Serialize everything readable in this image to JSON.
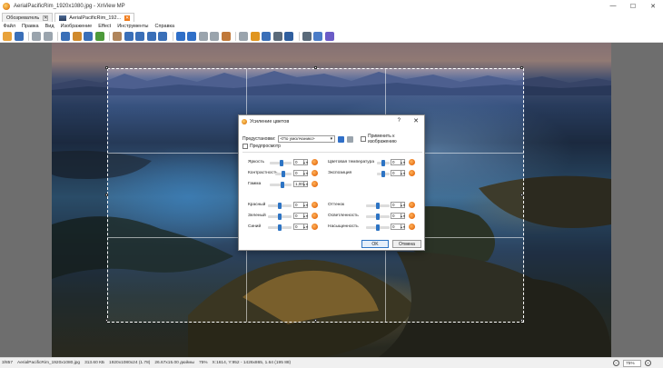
{
  "window": {
    "title": "AerialPacificRim_1920x1080.jpg - XnView MP",
    "minimize": "—",
    "maximize": "☐",
    "close": "✕"
  },
  "tabs": [
    {
      "label": "Обозреватель",
      "close": "✕"
    },
    {
      "label": "AerialPacificRim_192...",
      "close": "✕"
    }
  ],
  "menu": [
    "Файл",
    "Правка",
    "Вид",
    "Изображение",
    "Effect",
    "Инструменты",
    "Справка"
  ],
  "toolbar": {
    "icons": [
      "browse-icon",
      "save-icon",
      "undo-icon",
      "redo-icon",
      "fullscreen-icon",
      "filmstrip-icon",
      "thumbnail-icon",
      "refresh-icon",
      "resize-icon",
      "zoom-in-icon",
      "zoom-out-icon",
      "zoom-fit-icon",
      "zoom-actual-icon",
      "prev-icon",
      "next-icon",
      "rotate-left-icon",
      "rotate-right-icon",
      "crop-icon",
      "flip-icon",
      "adjust-icon",
      "settings-icon",
      "print-icon",
      "slideshow-icon",
      "color-icon",
      "info-icon",
      "help-icon"
    ],
    "colors": [
      "#e8a23a",
      "#3a6fb8",
      "#9aa4ad",
      "#9aa4ad",
      "#3a6fb8",
      "#d08a2c",
      "#3a6fb8",
      "#4d9a3a",
      "#b0855b",
      "#3a6fb8",
      "#3a6fb8",
      "#3a6fb8",
      "#3a6fb8",
      "#2f6fc8",
      "#2f6fc8",
      "#9aa4ad",
      "#9aa4ad",
      "#c0793a",
      "#9aa4ad",
      "#e0951f",
      "#3a6fb8",
      "#5a6a7a",
      "#2f5e9e",
      "#5a6a7a",
      "#4a7cc7",
      "#6b5cc7"
    ]
  },
  "dialog": {
    "title": "Усиление цветов",
    "help": "?",
    "close": "✕",
    "preset_label": "Предустановки:",
    "preset_value": "<По умолчанию>",
    "apply_label": "Применить к изображению",
    "preview_label": "Предпросмотр",
    "left_params": [
      {
        "label": "Яркость",
        "value": "0"
      },
      {
        "label": "Контрастность",
        "value": "0"
      },
      {
        "label": "Гамма",
        "value": "1,00"
      }
    ],
    "right_params": [
      {
        "label": "Цветовая температура",
        "value": "0"
      },
      {
        "label": "Экспозиция",
        "value": "0"
      }
    ],
    "rgb_params": [
      {
        "label": "Красный",
        "value": "0"
      },
      {
        "label": "Зеленый",
        "value": "0"
      },
      {
        "label": "Синий",
        "value": "0"
      }
    ],
    "hsl_params": [
      {
        "label": "Оттенок",
        "value": "0"
      },
      {
        "label": "Осветленность",
        "value": "0"
      },
      {
        "label": "Насыщенность",
        "value": "0"
      }
    ],
    "ok": "OK",
    "cancel": "Отмена"
  },
  "status": {
    "index": "3/857",
    "filename": "AerialPacificRim_1920x1080.jpg",
    "filesize": "313.60 КБ",
    "dims": "1920x1080x24 (1.78)",
    "inches": "26.67x15.00 дюймы",
    "zoom_pct": "75%",
    "coords": "X:1614, Y:952 - 1426x865, 1.64 (195 88)",
    "zoom_value": "75%"
  },
  "accent": "#f07a18"
}
